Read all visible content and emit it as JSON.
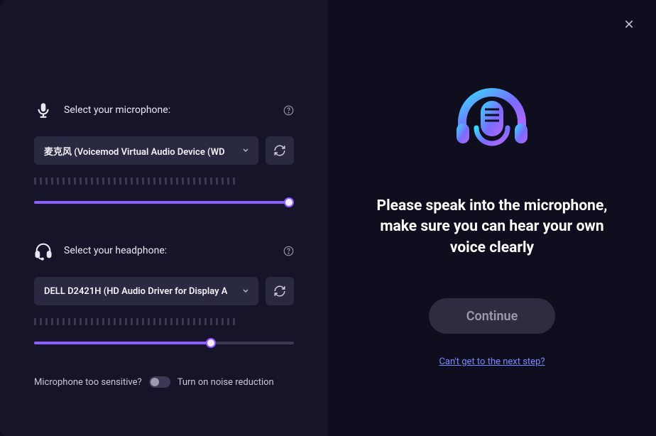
{
  "left": {
    "microphone": {
      "label": "Select your microphone:",
      "selected": "麦克风 (Voicemod Virtual Audio Device (WD",
      "slider_percent": 98
    },
    "headphone": {
      "label": "Select your headphone:",
      "selected": "DELL D2421H (HD Audio Driver for Display A",
      "slider_percent": 68
    },
    "noise": {
      "question": "Microphone too sensitive?",
      "action": "Turn on noise reduction",
      "enabled": false
    }
  },
  "right": {
    "instruction": "Please speak into the microphone, make sure you can hear your own voice clearly",
    "continue_label": "Continue",
    "help_link": "Can't get to the next step?"
  },
  "colors": {
    "accent": "#8e5cff"
  }
}
